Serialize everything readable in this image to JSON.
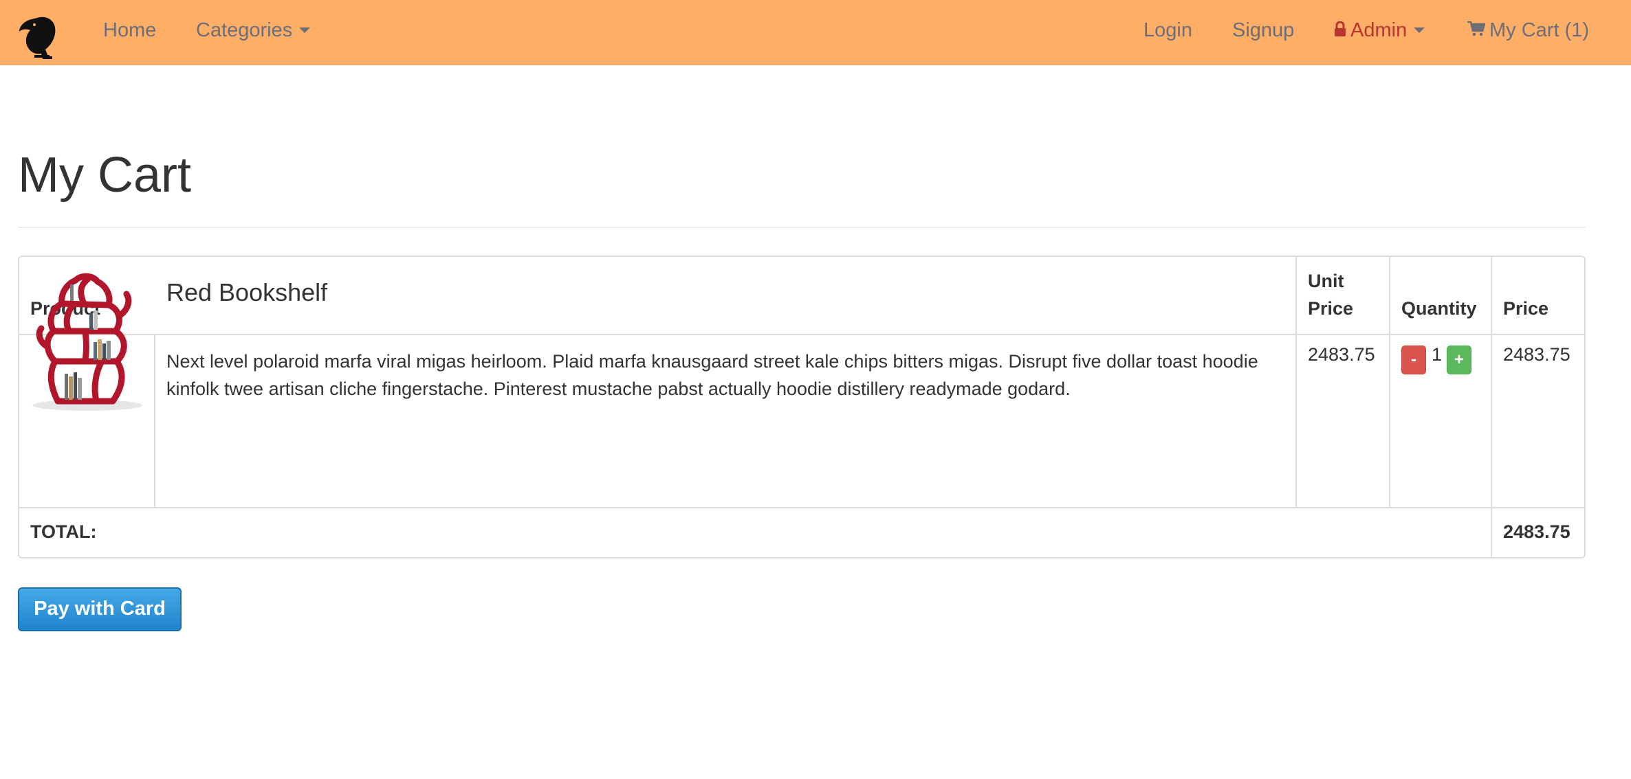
{
  "navbar": {
    "home_label": "Home",
    "categories_label": "Categories",
    "login_label": "Login",
    "signup_label": "Signup",
    "admin_label": "Admin",
    "cart_label": "My Cart (1)",
    "colors": {
      "background": "#ffae68",
      "link": "#6b6f75",
      "admin": "#b8342e"
    },
    "icons": {
      "brand": "toucan-logo-icon",
      "admin": "lock-icon",
      "cart": "shopping-cart-icon"
    }
  },
  "page": {
    "title": "My Cart"
  },
  "table": {
    "headers": {
      "product": "Product",
      "unit_price_line1": "Unit",
      "unit_price_line2": "Price",
      "quantity": "Quantity",
      "price": "Price"
    },
    "items": [
      {
        "name": "Red Bookshelf",
        "description": "Next level polaroid marfa viral migas heirloom. Plaid marfa knausgaard street kale chips bitters migas. Disrupt five dollar toast hoodie kinfolk twee artisan cliche fingerstache. Pinterest mustache pabst actually hoodie distillery readymade godard.",
        "unit_price": "2483.75",
        "quantity": "1",
        "decrement_label": "-",
        "increment_label": "+",
        "price": "2483.75",
        "image": "red-bookshelf-image"
      }
    ],
    "total_label": "TOTAL:",
    "total_value": "2483.75"
  },
  "actions": {
    "pay_label": "Pay with Card",
    "pay_color": "#2a8fd8"
  }
}
